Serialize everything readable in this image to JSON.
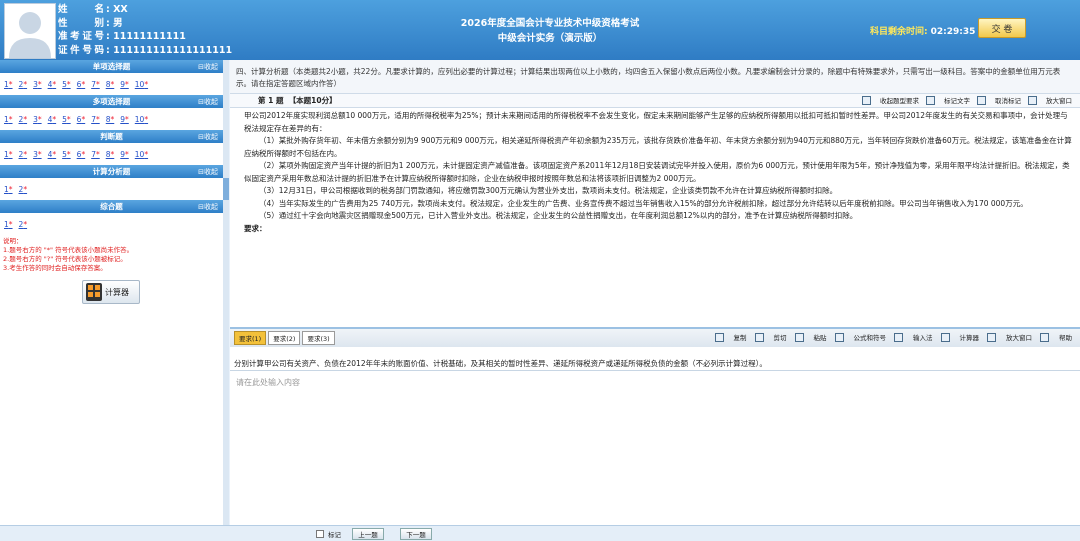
{
  "header": {
    "candidate": [
      {
        "label": "姓 名",
        "value": "XX"
      },
      {
        "label": "性 别",
        "value": "男"
      },
      {
        "label": "准考证号",
        "value": "11111111111"
      },
      {
        "label": "证件号码",
        "value": "111111111111111111"
      }
    ],
    "exam_title": "2026年度全国会计专业技术中级资格考试",
    "exam_subtitle": "中级会计实务（演示版）",
    "timer_label": "科目剩余时间:",
    "timer_value": "02:29:35",
    "submit_label": "交 卷"
  },
  "sidebar": {
    "collapse_label": "收起",
    "sections": [
      {
        "title": "单项选择题",
        "questions": [
          "1",
          "2",
          "3",
          "4",
          "5",
          "6",
          "7",
          "8",
          "9",
          "10"
        ]
      },
      {
        "title": "多项选择题",
        "questions": [
          "1",
          "2",
          "3",
          "4",
          "5",
          "6",
          "7",
          "8",
          "9",
          "10"
        ]
      },
      {
        "title": "判断题",
        "questions": [
          "1",
          "2",
          "3",
          "4",
          "5",
          "6",
          "7",
          "8",
          "9",
          "10"
        ]
      },
      {
        "title": "计算分析题",
        "questions": [
          "1",
          "2"
        ]
      },
      {
        "title": "综合题",
        "questions": [
          "1",
          "2"
        ]
      }
    ],
    "unanswered_mark": "*",
    "notes": [
      "说明：",
      "1.题号右方的 \"*\" 符号代表该小题尚未作答。",
      "2.题号右方的 \"?\" 符号代表该小题被标记。",
      "3.考生作答的同时会自动保存答案。"
    ],
    "calculator_label": "计算器"
  },
  "section_description": "四、计算分析题（本类题共2小题，共22分。凡要求计算的，应列出必要的计算过程；计算结果出现两位以上小数的，均四舍五入保留小数点后两位小数。凡要求编制会计分录的，除题中有特殊要求外，只需写出一级科目。答案中的金额单位用万元表示。请在指定答题区域内作答）",
  "question": {
    "number_label": "第 1 题",
    "score_label": "【本题10分】",
    "tools": [
      "收起题型要求",
      "标记文字",
      "取消标记",
      "放大窗口"
    ],
    "paragraphs": [
      "甲公司2012年度实现利润总额10 000万元，适用的所得税税率为25%；预计未来期间适用的所得税税率不会发生变化，假定未来期间能够产生足够的应纳税所得额用以抵扣可抵扣暂时性差异。甲公司2012年度发生的有关交易和事项中，会计处理与税法规定存在差异的有：",
      "（1）某批外购存货年初、年末借方余额分别为9 900万元和9 000万元，相关递延所得税资产年初余额为235万元，该批存货跌价准备年初、年末贷方余额分别为940万元和880万元，当年转回存货跌价准备60万元。税法规定，该笔准备金在计算应纳税所得额时不包括在内。",
      "（2）某项外购固定资产当年计提的折旧为1 200万元，未计提固定资产减值准备。该项固定资产系2011年12月18日安装调试完毕并投入使用，原价为6 000万元，预计使用年限为5年，预计净残值为零，采用年限平均法计提折旧。税法规定，类似固定资产采用年数总和法计提的折旧准予在计算应纳税所得额时扣除，企业在纳税申报时按照年数总和法将该项折旧调整为2 000万元。",
      "（3）12月31日，甲公司根据收到的税务部门罚款通知，将应缴罚款300万元确认为营业外支出，款项尚未支付。税法规定，企业该类罚款不允许在计算应纳税所得额时扣除。",
      "（4）当年实际发生的广告费用为25 740万元，款项尚未支付。税法规定，企业发生的广告费、业务宣传费不超过当年销售收入15%的部分允许税前扣除，超过部分允许结转以后年度税前扣除。甲公司当年销售收入为170 000万元。",
      "（5）通过红十字会向地震灾区捐赠现金500万元，已计入营业外支出。税法规定，企业发生的公益性捐赠支出，在年度利润总额12%以内的部分，准予在计算应纳税所得额时扣除。"
    ],
    "requirement_heading": "要求："
  },
  "answer_area": {
    "tabs": [
      "要求(1)",
      "要求(2)",
      "要求(3)"
    ],
    "active_tab": 0,
    "tools": [
      "复制",
      "剪切",
      "粘贴",
      "公式和符号",
      "输入法",
      "计算器",
      "放大窗口",
      "帮助"
    ],
    "requirement_text": "分别计算甲公司有关资产、负债在2012年年末的账面价值、计税基础，及其相关的暂时性差异、递延所得税资产或递延所得税负债的金额（不必列示计算过程）。",
    "placeholder": "请在此处输入内容"
  },
  "footer": {
    "flag_label": "标记",
    "prev_label": "上一题",
    "next_label": "下一题"
  }
}
